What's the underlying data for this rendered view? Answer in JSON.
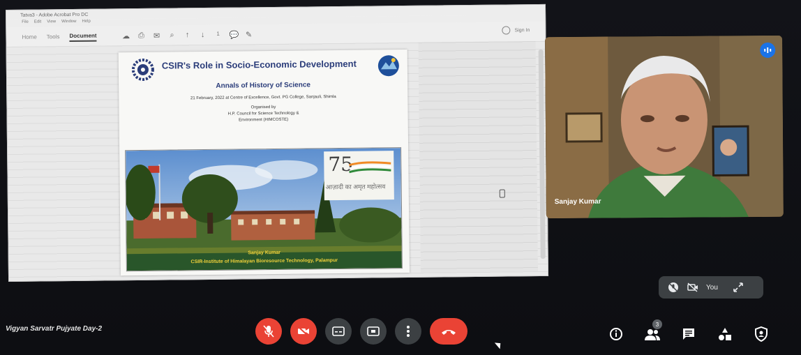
{
  "shared_window": {
    "title": "Tatva3 - Adobe Acrobat Pro DC",
    "menu": [
      "File",
      "Edit",
      "View",
      "Window",
      "Help"
    ],
    "tabs": [
      {
        "label": "Home",
        "active": false
      },
      {
        "label": "Tools",
        "active": false
      },
      {
        "label": "Document",
        "active": true
      }
    ],
    "page_number": "1",
    "sign_in": "Sign In"
  },
  "slide": {
    "title": "CSIR's Role in Socio-Economic Development",
    "subtitle": "Annals of History of Science",
    "detail": "21 February, 2022 at Centre of Excellence, Govt. PG College, Sanjauli, Shimla",
    "organised_by": "Organised by",
    "org_line1": "H.P. Council for Science Technology &",
    "org_line2": "Environment (HIMCOSTE)",
    "azadi_number": "75",
    "azadi_hindi": "आज़ादी का अमृत महोत्सव",
    "caption_name": "Sanjay Kumar",
    "caption_institute": "CSIR-Institute of Himalayan Bioresource Technology, Palampur"
  },
  "participant": {
    "name": "Sanjay Kumar"
  },
  "self_view": {
    "label": "You"
  },
  "toolbar": {
    "meeting_title": "Vigyan Sarvatr Pujyate Day-2",
    "participants_count": "3"
  },
  "colors": {
    "danger": "#ea4335",
    "control_bg": "#3c4043",
    "accent": "#1a73e8"
  }
}
